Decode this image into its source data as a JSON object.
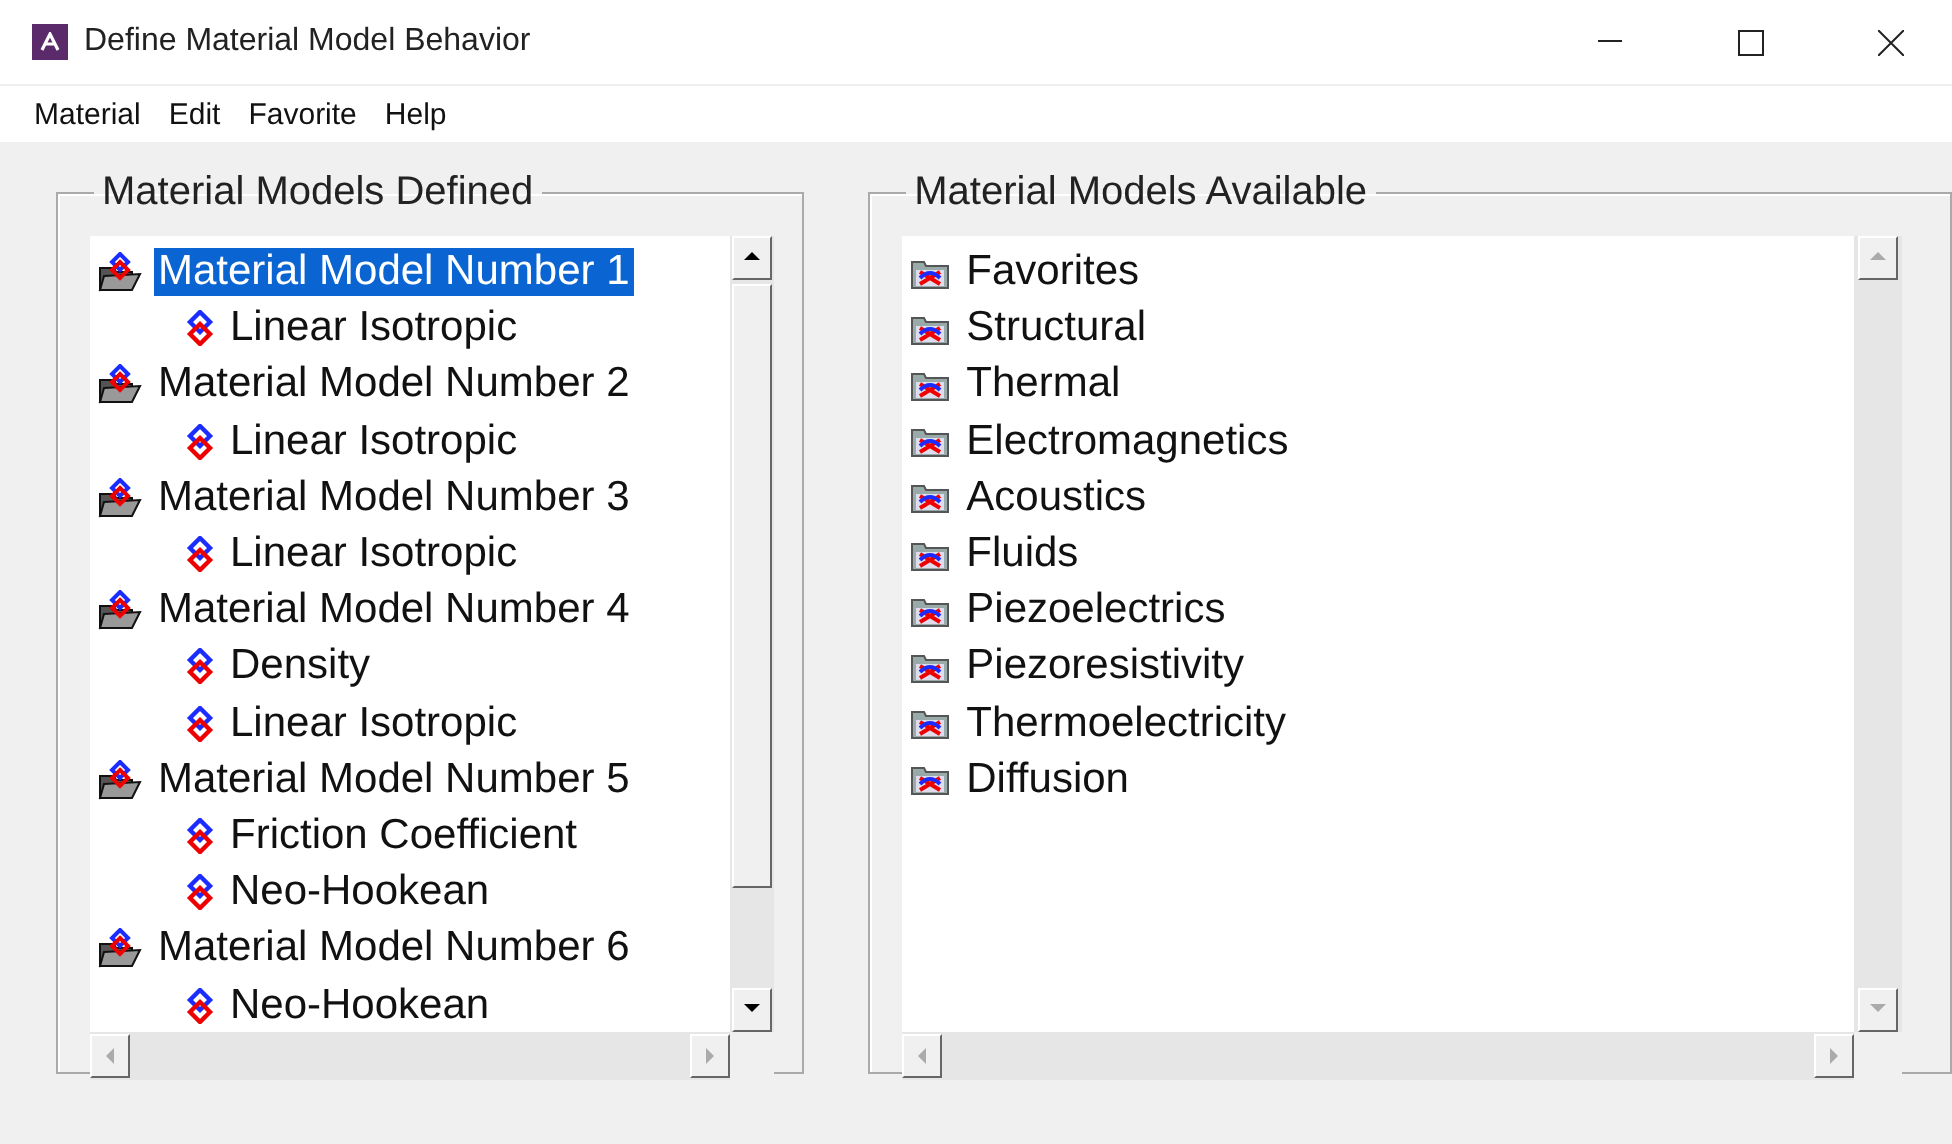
{
  "window": {
    "title": "Define Material Model Behavior"
  },
  "menu": [
    "Material",
    "Edit",
    "Favorite",
    "Help"
  ],
  "defined": {
    "title": "Material Models Defined",
    "scroll_enabled": true,
    "items": [
      {
        "label": "Material Model Number 1",
        "selected": true,
        "children": [
          {
            "label": "Linear Isotropic",
            "selected": false
          }
        ]
      },
      {
        "label": "Material Model Number 2",
        "selected": false,
        "children": [
          {
            "label": "Linear Isotropic",
            "selected": false
          }
        ]
      },
      {
        "label": "Material Model Number 3",
        "selected": false,
        "children": [
          {
            "label": "Linear Isotropic",
            "selected": false
          }
        ]
      },
      {
        "label": "Material Model Number 4",
        "selected": false,
        "children": [
          {
            "label": "Density",
            "selected": false
          },
          {
            "label": "Linear Isotropic",
            "selected": false
          }
        ]
      },
      {
        "label": "Material Model Number 5",
        "selected": false,
        "children": [
          {
            "label": "Friction Coefficient",
            "selected": false
          },
          {
            "label": "Neo-Hookean",
            "selected": false
          }
        ]
      },
      {
        "label": "Material Model Number 6",
        "selected": false,
        "children": [
          {
            "label": "Neo-Hookean",
            "selected": false
          }
        ]
      }
    ]
  },
  "available": {
    "title": "Material Models Available",
    "scroll_enabled": false,
    "items": [
      {
        "label": "Favorites",
        "selected": false
      },
      {
        "label": "Structural",
        "selected": false
      },
      {
        "label": "Thermal",
        "selected": false
      },
      {
        "label": "Electromagnetics",
        "selected": false
      },
      {
        "label": "Acoustics",
        "selected": false
      },
      {
        "label": "Fluids",
        "selected": false
      },
      {
        "label": "Piezoelectrics",
        "selected": false
      },
      {
        "label": "Piezoresistivity",
        "selected": false
      },
      {
        "label": "Thermoelectricity",
        "selected": false
      },
      {
        "label": "Diffusion",
        "selected": false
      }
    ]
  }
}
